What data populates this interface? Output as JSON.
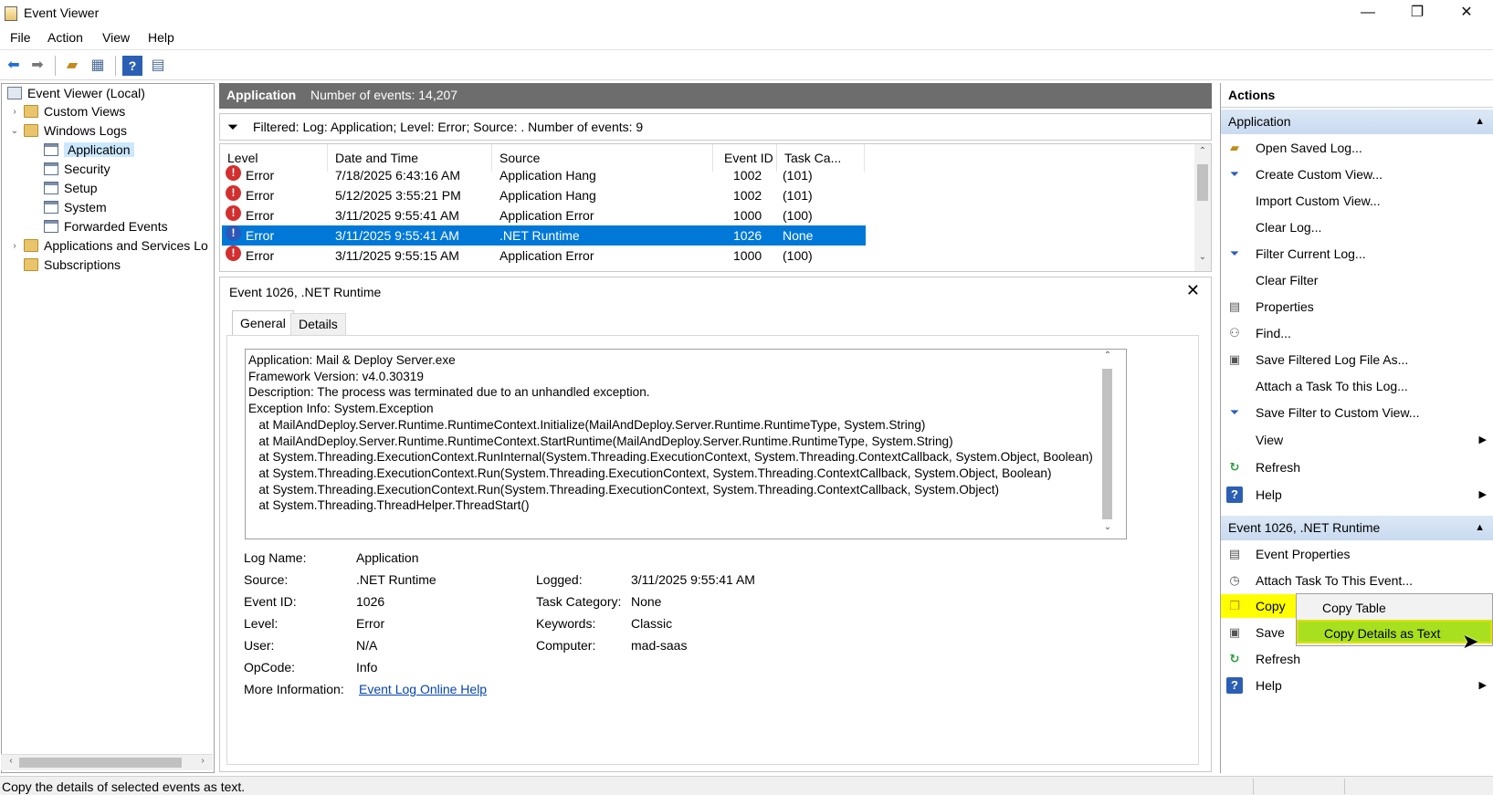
{
  "window": {
    "title": "Event Viewer",
    "minimize_glyph": "—",
    "restore_glyph": "❐",
    "close_glyph": "✕"
  },
  "menu": [
    "File",
    "Action",
    "View",
    "Help"
  ],
  "toolbar": {
    "icons": [
      "back-arrow-icon",
      "forward-arrow-icon",
      "up-folder-icon",
      "show-hide-console-tree-icon",
      "help-icon",
      "show-hide-action-pane-icon"
    ]
  },
  "tree": {
    "root": "Event Viewer (Local)",
    "custom_views": "Custom Views",
    "windows_logs": "Windows Logs",
    "application": "Application",
    "security": "Security",
    "setup": "Setup",
    "system": "System",
    "forwarded_events": "Forwarded Events",
    "apps_services": "Applications and Services Lo",
    "subscriptions": "Subscriptions"
  },
  "center": {
    "log_name": "Application",
    "event_count": "Number of events: 14,207",
    "filter_text": "Filtered: Log: Application; Level: Error; Source: . Number of events: 9"
  },
  "columns": [
    "Level",
    "Date and Time",
    "Source",
    "Event ID",
    "Task Ca..."
  ],
  "events": [
    {
      "level": "Error",
      "datetime": "7/18/2025 6:43:16 AM",
      "source": "Application Hang",
      "event_id": "1002",
      "task": "(101)"
    },
    {
      "level": "Error",
      "datetime": "5/12/2025 3:55:21 PM",
      "source": "Application Hang",
      "event_id": "1002",
      "task": "(101)"
    },
    {
      "level": "Error",
      "datetime": "3/11/2025 9:55:41 AM",
      "source": "Application Error",
      "event_id": "1000",
      "task": "(100)"
    },
    {
      "level": "Error",
      "datetime": "3/11/2025 9:55:41 AM",
      "source": ".NET Runtime",
      "event_id": "1026",
      "task": "None"
    },
    {
      "level": "Error",
      "datetime": "3/11/2025 9:55:15 AM",
      "source": "Application Error",
      "event_id": "1000",
      "task": "(100)"
    }
  ],
  "detail": {
    "title": "Event 1026, .NET Runtime",
    "tab_general": "General",
    "tab_details": "Details",
    "description": "Application: Mail & Deploy Server.exe\nFramework Version: v4.0.30319\nDescription: The process was terminated due to an unhandled exception.\nException Info: System.Exception\n   at MailAndDeploy.Server.Runtime.RuntimeContext.Initialize(MailAndDeploy.Server.Runtime.RuntimeType, System.String)\n   at MailAndDeploy.Server.Runtime.RuntimeContext.StartRuntime(MailAndDeploy.Server.Runtime.RuntimeType, System.String)\n   at System.Threading.ExecutionContext.RunInternal(System.Threading.ExecutionContext, System.Threading.ContextCallback, System.Object, Boolean)\n   at System.Threading.ExecutionContext.Run(System.Threading.ExecutionContext, System.Threading.ContextCallback, System.Object, Boolean)\n   at System.Threading.ExecutionContext.Run(System.Threading.ExecutionContext, System.Threading.ContextCallback, System.Object)\n   at System.Threading.ThreadHelper.ThreadStart()",
    "fields": {
      "log_name_label": "Log Name:",
      "log_name": "Application",
      "source_label": "Source:",
      "source": ".NET Runtime",
      "logged_label": "Logged:",
      "logged": "3/11/2025 9:55:41 AM",
      "event_id_label": "Event ID:",
      "event_id": "1026",
      "task_category_label": "Task Category:",
      "task_category": "None",
      "level_label": "Level:",
      "level": "Error",
      "keywords_label": "Keywords:",
      "keywords": "Classic",
      "user_label": "User:",
      "user": "N/A",
      "computer_label": "Computer:",
      "computer": "mad-saas",
      "opcode_label": "OpCode:",
      "opcode": "Info",
      "more_info_label": "More Information:",
      "more_info_link": "Event Log Online Help"
    }
  },
  "actions": {
    "header": "Actions",
    "section1": "Application",
    "section1_items": [
      {
        "label": "Open Saved Log...",
        "icon": "open-folder-icon"
      },
      {
        "label": "Create Custom View...",
        "icon": "filter-icon"
      },
      {
        "label": "Import Custom View...",
        "icon": ""
      },
      {
        "label": "Clear Log...",
        "icon": ""
      },
      {
        "label": "Filter Current Log...",
        "icon": "filter-icon"
      },
      {
        "label": "Clear Filter",
        "icon": ""
      },
      {
        "label": "Properties",
        "icon": "properties-icon"
      },
      {
        "label": "Find...",
        "icon": "binoculars-icon"
      },
      {
        "label": "Save Filtered Log File As...",
        "icon": "save-icon"
      },
      {
        "label": "Attach a Task To this Log...",
        "icon": ""
      },
      {
        "label": "Save Filter to Custom View...",
        "icon": "save-filter-icon"
      },
      {
        "label": "View",
        "icon": ""
      },
      {
        "label": "Refresh",
        "icon": "refresh-icon"
      },
      {
        "label": "Help",
        "icon": "help-icon"
      }
    ],
    "section2": "Event 1026, .NET Runtime",
    "section2_items": [
      {
        "label": "Event Properties",
        "icon": "properties-icon"
      },
      {
        "label": "Attach Task To This Event...",
        "icon": "task-icon"
      },
      {
        "label": "Copy",
        "icon": "copy-icon"
      },
      {
        "label": "Save",
        "icon": "save-icon"
      },
      {
        "label": "Refresh",
        "icon": "refresh-icon"
      },
      {
        "label": "Help",
        "icon": "help-icon"
      }
    ],
    "submenu": [
      "Copy Table",
      "Copy Details as Text"
    ]
  },
  "status": "Copy the details of selected events as text.",
  "colors": {
    "selection": "#0078d7",
    "highlight": "#ffff00",
    "submenu_active": "#a8e020",
    "header_bg": "#6d6d6d",
    "section_bg": "#c9daf0"
  }
}
